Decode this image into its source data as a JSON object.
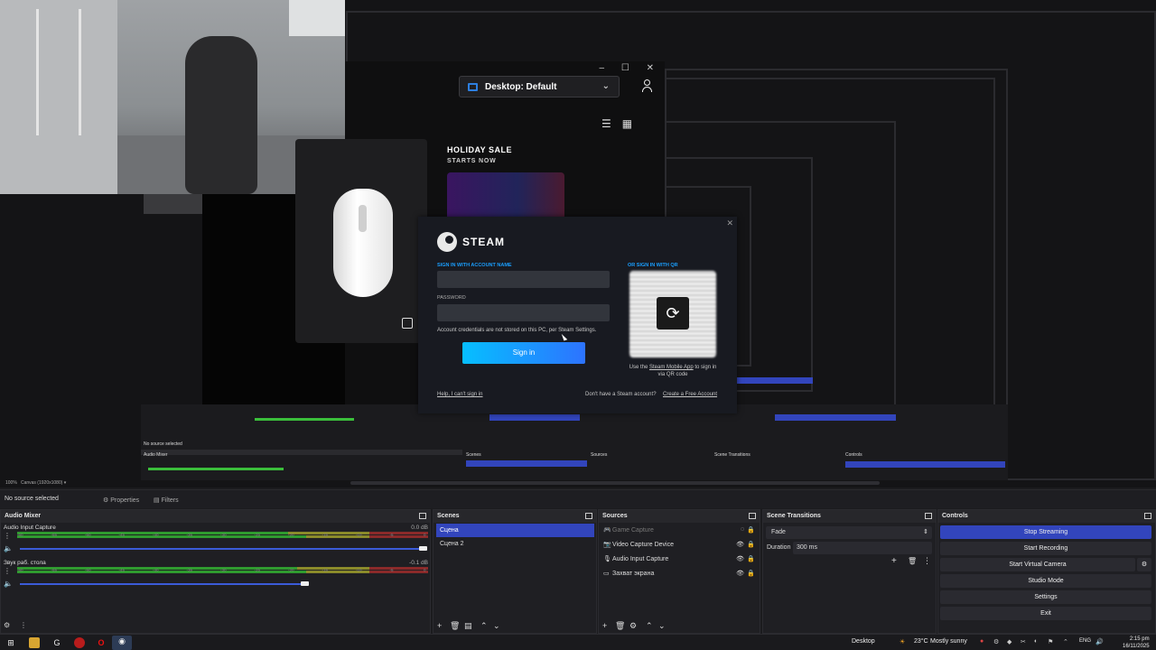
{
  "game_app": {
    "profile": "Desktop: Default",
    "sale_title": "HOLIDAY SALE",
    "sale_subtitle": "STARTS NOW"
  },
  "steam_login": {
    "brand": "STEAM",
    "account_label": "SIGN IN WITH ACCOUNT NAME",
    "password_label": "PASSWORD",
    "note": "Account credentials are not stored on this PC, per Steam Settings.",
    "signin_button": "Sign in",
    "qr_label": "OR SIGN IN WITH QR",
    "qr_help_pre": "Use the",
    "qr_help_link": "Steam Mobile App",
    "qr_help_post": "to sign in via QR code",
    "cant_sign_in": "Help, I can't sign in",
    "no_account": "Don't have a Steam account?",
    "create_account": "Create a Free Account"
  },
  "preview": {
    "canvas_zoom": "100%",
    "canvas_label": "Canvas (1920x1080)"
  },
  "status_row": {
    "no_source": "No source selected",
    "properties": "Properties",
    "filters": "Filters"
  },
  "audio_mixer": {
    "title": "Audio Mixer",
    "channels": [
      {
        "name": "Audio Input Capture",
        "db": "0.0 dB",
        "level": 0.74,
        "volume": 1.0
      },
      {
        "name": "Звук раб. стола",
        "db": "-0.1 dB",
        "level": 0.8,
        "volume": 0.7
      }
    ],
    "ticks": [
      "-60",
      "-55",
      "-50",
      "-45",
      "-40",
      "-35",
      "-30",
      "-25",
      "-20",
      "-15",
      "-10",
      "-5",
      "0"
    ]
  },
  "scenes": {
    "title": "Scenes",
    "items": [
      "Сцена",
      "Сцена 2"
    ],
    "active_index": 0
  },
  "sources": {
    "title": "Sources",
    "items": [
      {
        "name": "Game Capture",
        "icon": "gamepad-icon",
        "visible": false
      },
      {
        "name": "Video Capture Device",
        "icon": "camera-icon",
        "visible": true
      },
      {
        "name": "Audio Input Capture",
        "icon": "microphone-icon",
        "visible": true
      },
      {
        "name": "Захват экрана",
        "icon": "monitor-icon",
        "visible": true
      }
    ]
  },
  "transitions": {
    "title": "Scene Transitions",
    "selected": "Fade",
    "duration_label": "Duration",
    "duration_value": "300 ms"
  },
  "controls": {
    "title": "Controls",
    "buttons": [
      "Stop Streaming",
      "Start Recording",
      "Start Virtual Camera",
      "Studio Mode",
      "Settings",
      "Exit"
    ]
  },
  "taskbar": {
    "desktop_label": "Desktop",
    "temperature": "23°C",
    "condition": "Mostly sunny",
    "language": "ENG",
    "time": "2:15 pm",
    "date": "16/11/2025"
  },
  "colors": {
    "accent_blue": "#3245bc",
    "steam_blue": "#1a9fff",
    "meter_green": "#2f9a2f"
  }
}
